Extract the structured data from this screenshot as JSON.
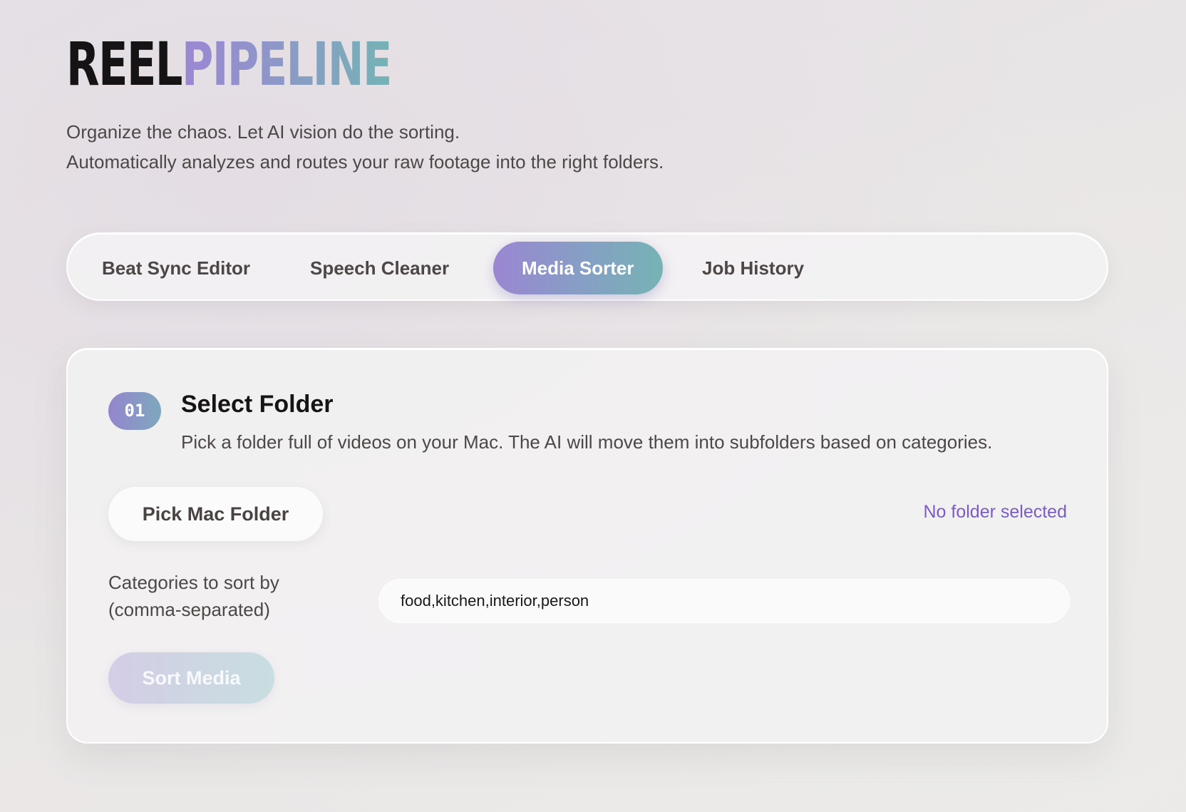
{
  "brand": {
    "part1": "REEL",
    "part2": "PIPELINE"
  },
  "tagline": {
    "line1": "Organize the chaos. Let AI vision do the sorting.",
    "line2": "Automatically analyzes and routes your raw footage into the right folders."
  },
  "tabs": [
    {
      "label": "Beat Sync Editor",
      "active": false
    },
    {
      "label": "Speech Cleaner",
      "active": false
    },
    {
      "label": "Media Sorter",
      "active": true
    },
    {
      "label": "Job History",
      "active": false
    }
  ],
  "step": {
    "number": "01",
    "title": "Select Folder",
    "description": "Pick a folder full of videos on your Mac. The AI will move them into subfolders based on categories.",
    "pick_button_label": "Pick Mac Folder",
    "folder_status": "No folder selected",
    "categories_label": "Categories to sort by (comma-separated)",
    "categories_value": "food,kitchen,interior,person",
    "sort_button_label": "Sort Media"
  },
  "colors": {
    "accent_start": "#9a86d2",
    "accent_end": "#76b3b4",
    "status_text": "#7a5cc4"
  }
}
